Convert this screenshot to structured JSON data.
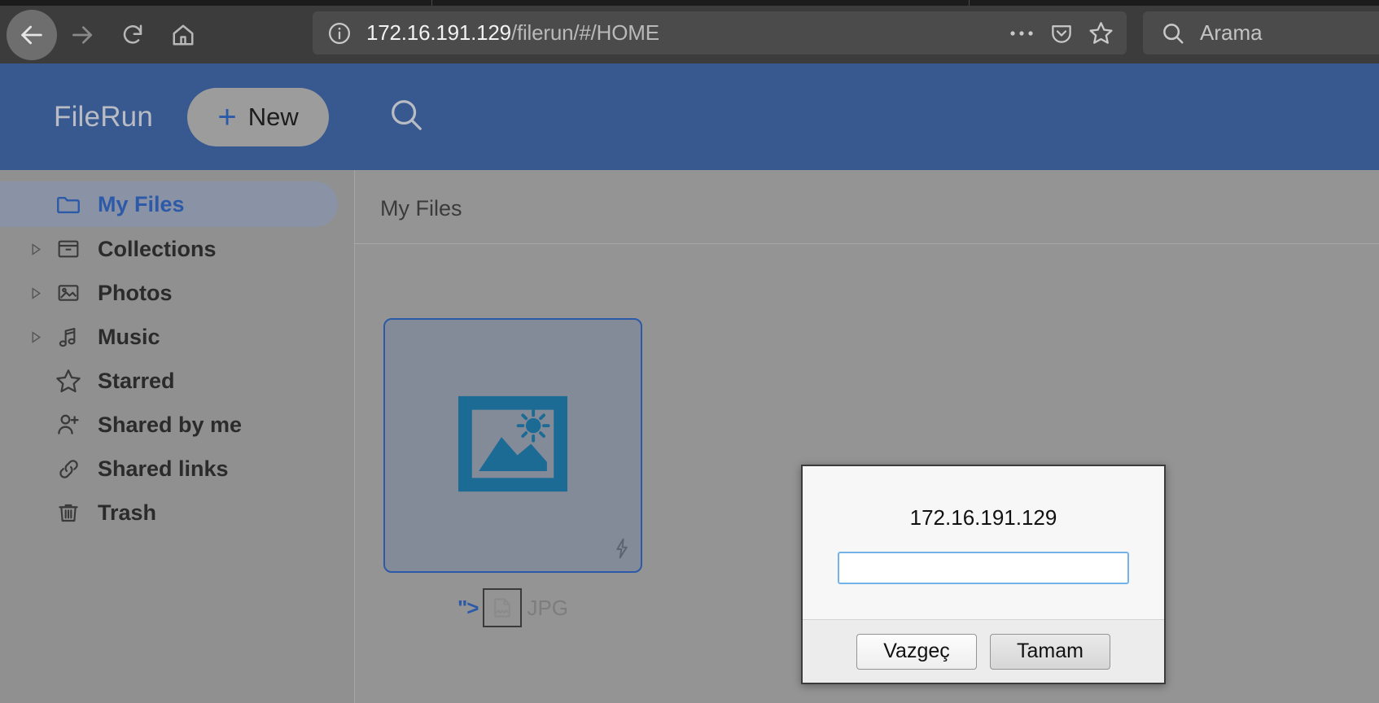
{
  "browser": {
    "nav": {
      "back_label": "Back",
      "forward_label": "Forward",
      "reload_label": "Reload",
      "home_label": "Home"
    },
    "url": {
      "host": "172.16.191.129",
      "path": "/filerun/#/HOME",
      "info_icon": "info-circle-icon"
    },
    "toolbar_icons": [
      "ellipsis-icon",
      "pocket-icon",
      "star-icon"
    ],
    "search": {
      "placeholder": "Arama",
      "icon": "search-icon"
    }
  },
  "app": {
    "brand": "FileRun",
    "new_button": {
      "plus": "+",
      "label": "New"
    },
    "header_search_icon": "search-icon",
    "accent_blue": "#37598f",
    "link_blue": "#2d5aa8"
  },
  "sidebar": {
    "items": [
      {
        "label": "My Files",
        "icon": "folder-icon",
        "expandable": false,
        "selected": true
      },
      {
        "label": "Collections",
        "icon": "archive-box-icon",
        "expandable": true,
        "selected": false
      },
      {
        "label": "Photos",
        "icon": "photo-icon",
        "expandable": true,
        "selected": false
      },
      {
        "label": "Music",
        "icon": "music-note-icon",
        "expandable": true,
        "selected": false
      },
      {
        "label": "Starred",
        "icon": "star-outline-icon",
        "expandable": false,
        "selected": false
      },
      {
        "label": "Shared by me",
        "icon": "user-plus-icon",
        "expandable": false,
        "selected": false
      },
      {
        "label": "Shared links",
        "icon": "link-chain-icon",
        "expandable": false,
        "selected": false
      },
      {
        "label": "Trash",
        "icon": "trash-icon",
        "expandable": false,
        "selected": false
      }
    ]
  },
  "content": {
    "breadcrumb": "My Files",
    "file": {
      "thumb_icon": "image-placeholder-icon",
      "badge_icon": "lightning-bolt-icon",
      "name_fragment": "\">",
      "broken_image_icon": "broken-image-icon",
      "extension": "JPG"
    }
  },
  "modal": {
    "title": "172.16.191.129",
    "input_value": "",
    "input_placeholder": "",
    "cancel_label": "Vazgeç",
    "ok_label": "Tamam"
  }
}
